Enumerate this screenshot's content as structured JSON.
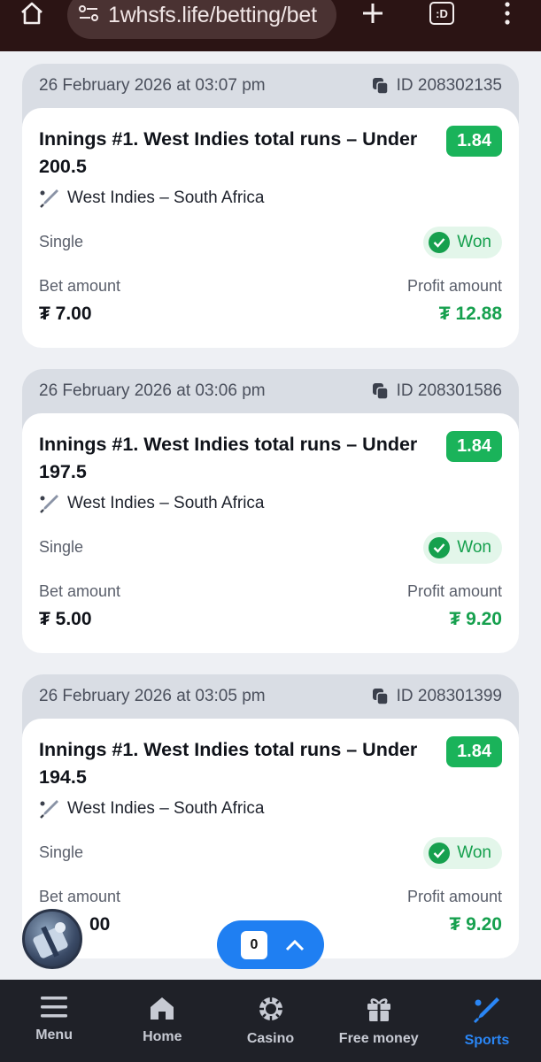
{
  "browser": {
    "url": "1whsfs.life/betting/bet",
    "tab_count": ":D",
    "icons": [
      "home-icon",
      "site-settings-icon",
      "new-tab-icon",
      "tabs-icon",
      "more-icon"
    ]
  },
  "bets": [
    {
      "date": "26 February 2026 at 03:07 pm",
      "id": "ID 208302135",
      "title": "Innings #1. West Indies total runs – Under 200.5",
      "odds": "1.84",
      "match": "West Indies – South Africa",
      "type": "Single",
      "status": "Won",
      "bet_label": "Bet amount",
      "bet_amount": "₮ 7.00",
      "profit_label": "Profit amount",
      "profit_amount": "₮ 12.88"
    },
    {
      "date": "26 February 2026 at 03:06 pm",
      "id": "ID 208301586",
      "title": "Innings #1. West Indies total runs – Under 197.5",
      "odds": "1.84",
      "match": "West Indies – South Africa",
      "type": "Single",
      "status": "Won",
      "bet_label": "Bet amount",
      "bet_amount": "₮ 5.00",
      "profit_label": "Profit amount",
      "profit_amount": "₮ 9.20"
    },
    {
      "date": "26 February 2026 at 03:05 pm",
      "id": "ID 208301399",
      "title": "Innings #1. West Indies total runs – Under 194.5",
      "odds": "1.84",
      "match": "West Indies – South Africa",
      "type": "Single",
      "status": "Won",
      "bet_label": "Bet amount",
      "bet_amount": "00",
      "profit_label": "Profit amount",
      "profit_amount": "₮ 9.20"
    }
  ],
  "coupon": {
    "count": "0"
  },
  "nav": [
    {
      "label": "Menu",
      "icon": "menu-icon"
    },
    {
      "label": "Home",
      "icon": "home-icon"
    },
    {
      "label": "Casino",
      "icon": "casino-chip-icon"
    },
    {
      "label": "Free money",
      "icon": "gift-icon"
    },
    {
      "label": "Sports",
      "icon": "cricket-bat-icon",
      "active": true
    }
  ],
  "colors": {
    "accent": "#2a86f5",
    "won": "#16a04e",
    "odds": "#1ab35a",
    "nav_bg": "#1f2128",
    "chrome_bg": "#2b1414"
  }
}
